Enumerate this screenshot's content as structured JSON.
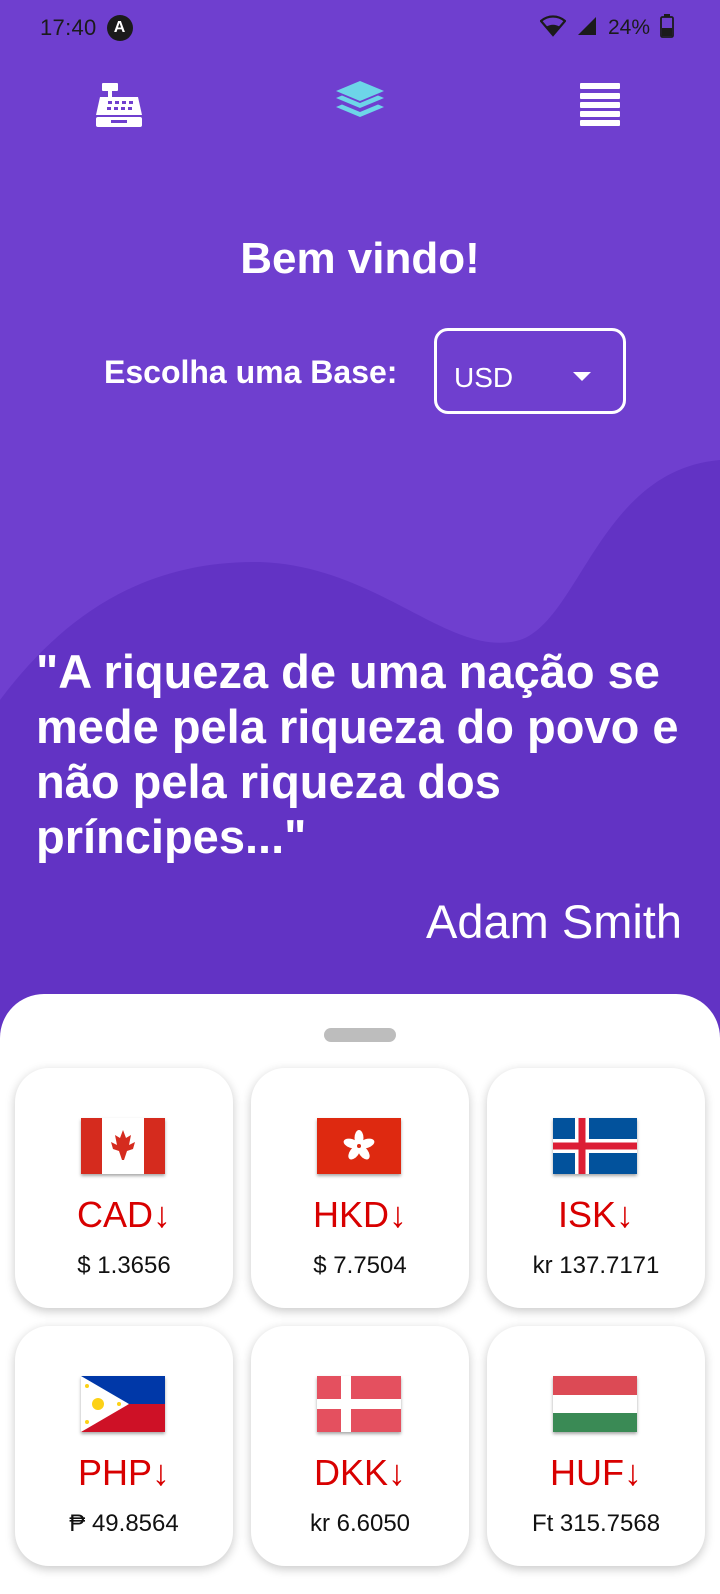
{
  "status_bar": {
    "time": "17:40",
    "badge": "A",
    "battery": "24%"
  },
  "nav": {
    "left_icon": "cash-register-icon",
    "center_icon": "layers-icon",
    "right_icon": "menu-icon"
  },
  "welcome": "Bem vindo!",
  "base": {
    "label": "Escolha uma Base:",
    "selected": "USD"
  },
  "quote": {
    "text": "\"A riqueza de uma nação se mede pela riqueza do povo e não pela riqueza dos príncipes...\"",
    "author": "Adam Smith"
  },
  "colors": {
    "background": "#6f3fcf",
    "wave": "#6233c4",
    "accent_icon": "#6dd5e8",
    "down_red": "#d80000"
  },
  "currencies": [
    {
      "code": "CAD",
      "rate": "$ 1.3656",
      "trend": "↓",
      "flag": "canada-flag-icon"
    },
    {
      "code": "HKD",
      "rate": "$ 7.7504",
      "trend": "↓",
      "flag": "hong-kong-flag-icon"
    },
    {
      "code": "ISK",
      "rate": "kr 137.7171",
      "trend": "↓",
      "flag": "iceland-flag-icon"
    },
    {
      "code": "PHP",
      "rate": "₱ 49.8564",
      "trend": "↓",
      "flag": "philippines-flag-icon"
    },
    {
      "code": "DKK",
      "rate": "kr 6.6050",
      "trend": "↓",
      "flag": "denmark-flag-icon"
    },
    {
      "code": "HUF",
      "rate": "Ft 315.7568",
      "trend": "↓",
      "flag": "hungary-flag-icon"
    }
  ]
}
